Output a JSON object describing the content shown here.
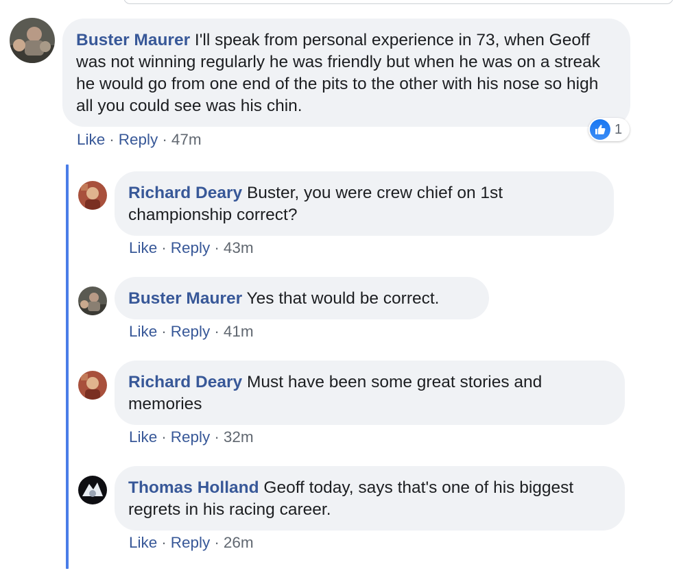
{
  "comment": {
    "author": "Buster Maurer",
    "text": " I'll speak from personal experience in 73, when Geoff was not winning regularly he was friendly but when he was on a streak he would go from one end of the pits to the other with his nose so high all you could see was his chin.",
    "like_label": "Like",
    "reply_label": "Reply",
    "time": "47m",
    "reaction_count": "1",
    "reaction_icon": "thumbs-up-icon",
    "accent_color": "#1877f2"
  },
  "replies": [
    {
      "author": "Richard Deary",
      "text": " Buster, you were crew chief on 1st championship correct?",
      "like_label": "Like",
      "reply_label": "Reply",
      "time": "43m"
    },
    {
      "author": "Buster Maurer",
      "text": " Yes that would be correct.",
      "like_label": "Like",
      "reply_label": "Reply",
      "time": "41m"
    },
    {
      "author": "Richard Deary",
      "text": " Must have been some great stories and memories",
      "like_label": "Like",
      "reply_label": "Reply",
      "time": "32m"
    },
    {
      "author": "Thomas Holland",
      "text": " Geoff today, says that's one of his biggest regrets in his racing career.",
      "like_label": "Like",
      "reply_label": "Reply",
      "time": "26m"
    }
  ],
  "separator": "·",
  "colors": {
    "author": "#385898",
    "bubble": "#f0f2f5",
    "thread_line": "#4a7de8",
    "meta": "#606770"
  }
}
